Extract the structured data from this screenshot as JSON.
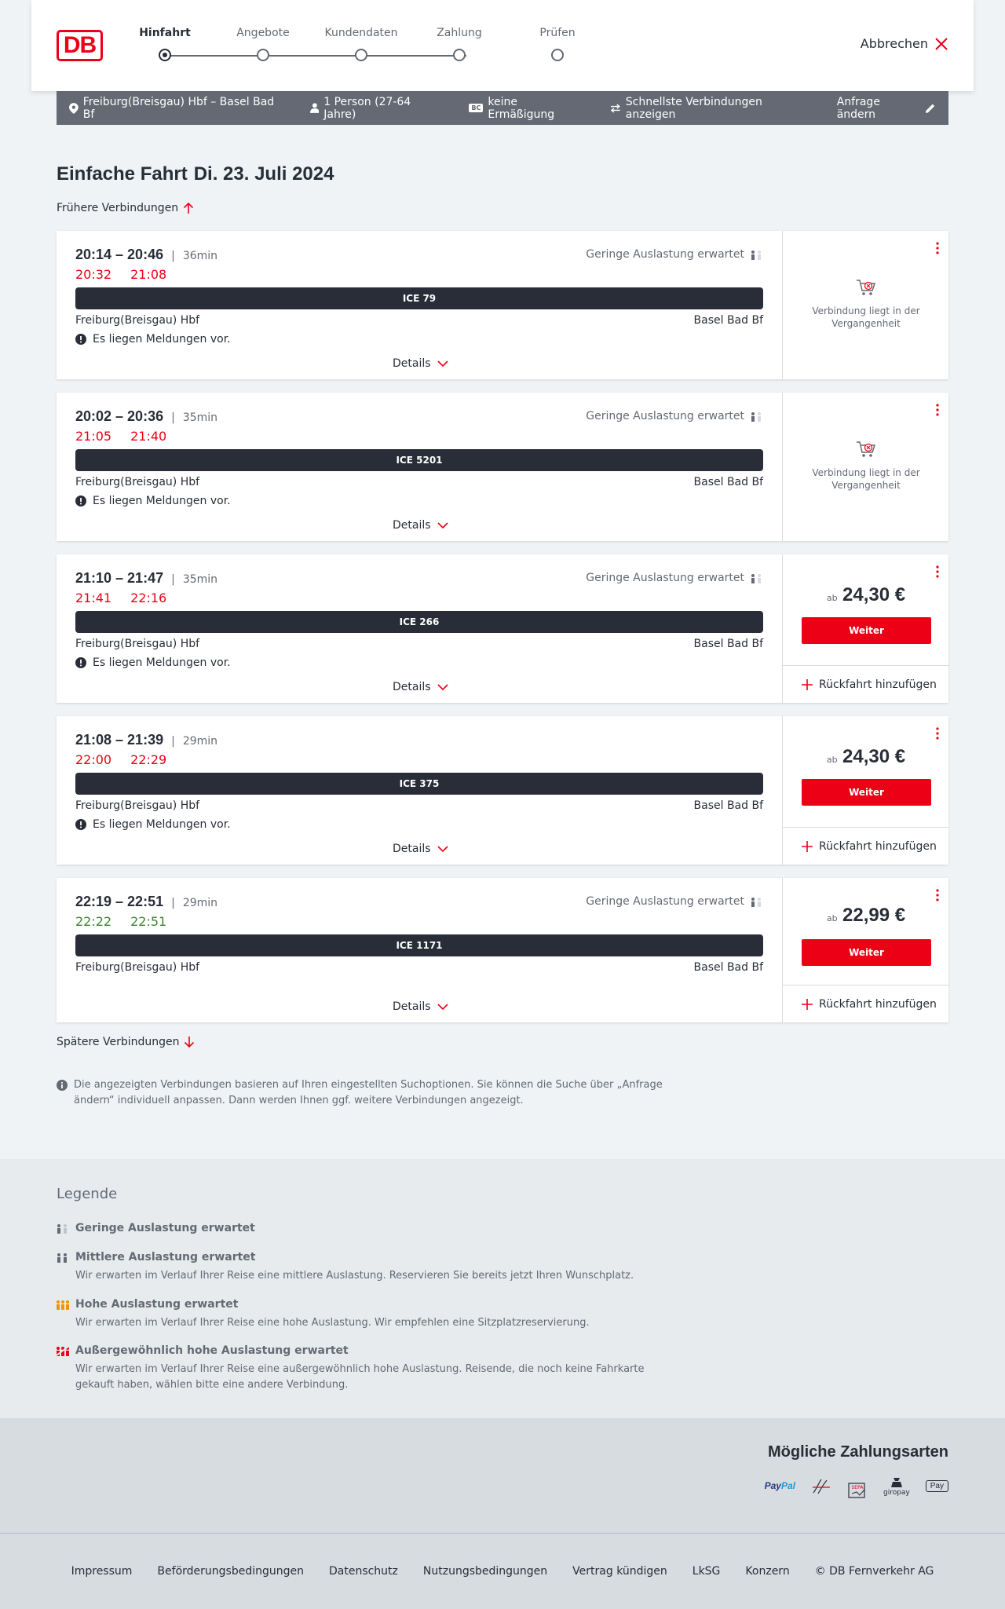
{
  "header": {
    "logo": "DB",
    "steps": [
      {
        "label": "Hinfahrt",
        "active": true
      },
      {
        "label": "Angebote",
        "active": false
      },
      {
        "label": "Kundendaten",
        "active": false
      },
      {
        "label": "Zahlung",
        "active": false
      },
      {
        "label": "Prüfen",
        "active": false
      }
    ],
    "cancel_label": "Abbrechen"
  },
  "infobar": {
    "route": "Freiburg(Breisgau) Hbf – Basel Bad Bf",
    "travellers": "1 Person (27-64 Jahre)",
    "discount_badge": "BC",
    "discount": "keine Ermäßigung",
    "filter": "Schnellste Verbindungen anzeigen",
    "change": "Anfrage ändern"
  },
  "heading": {
    "title": "Einfache Fahrt",
    "date": "Di. 23. Juli 2024"
  },
  "earlier_label": "Frühere Verbindungen",
  "later_label": "Spätere Verbindungen",
  "connections": [
    {
      "times": "20:14 – 20:46",
      "duration": "36min",
      "rt_dep": "20:32",
      "rt_arr": "21:08",
      "rt_color": "red",
      "load": "Geringe Auslastung erwartet",
      "train": "ICE 79",
      "from": "Freiburg(Breisgau) Hbf",
      "to": "Basel Bad Bf",
      "message": "Es liegen Meldungen vor.",
      "details": "Details",
      "status": "past",
      "past_text": "Verbindung liegt in der Vergangenheit"
    },
    {
      "times": "20:02 – 20:36",
      "duration": "35min",
      "rt_dep": "21:05",
      "rt_arr": "21:40",
      "rt_color": "red",
      "load": "Geringe Auslastung erwartet",
      "train": "ICE 5201",
      "from": "Freiburg(Breisgau) Hbf",
      "to": "Basel Bad Bf",
      "message": "Es liegen Meldungen vor.",
      "details": "Details",
      "status": "past",
      "past_text": "Verbindung liegt in der Vergangenheit"
    },
    {
      "times": "21:10 – 21:47",
      "duration": "35min",
      "rt_dep": "21:41",
      "rt_arr": "22:16",
      "rt_color": "red",
      "load": "Geringe Auslastung erwartet",
      "train": "ICE 266",
      "from": "Freiburg(Breisgau) Hbf",
      "to": "Basel Bad Bf",
      "message": "Es liegen Meldungen vor.",
      "details": "Details",
      "status": "bookable",
      "price_prefix": "ab",
      "price": "24,30 €",
      "button": "Weiter",
      "return_label": "Rückfahrt hinzufügen"
    },
    {
      "times": "21:08 – 21:39",
      "duration": "29min",
      "rt_dep": "22:00",
      "rt_arr": "22:29",
      "rt_color": "red",
      "load": "",
      "train": "ICE 375",
      "from": "Freiburg(Breisgau) Hbf",
      "to": "Basel Bad Bf",
      "message": "Es liegen Meldungen vor.",
      "details": "Details",
      "status": "bookable",
      "price_prefix": "ab",
      "price": "24,30 €",
      "button": "Weiter",
      "return_label": "Rückfahrt hinzufügen"
    },
    {
      "times": "22:19 – 22:51",
      "duration": "29min",
      "rt_dep": "22:22",
      "rt_arr": "22:51",
      "rt_color": "green",
      "load": "Geringe Auslastung erwartet",
      "train": "ICE 1171",
      "from": "Freiburg(Breisgau) Hbf",
      "to": "Basel Bad Bf",
      "message": "",
      "details": "Details",
      "status": "bookable",
      "price_prefix": "ab",
      "price": "22,99 €",
      "button": "Weiter",
      "return_label": "Rückfahrt hinzufügen"
    }
  ],
  "note": "Die angezeigten Verbindungen basieren auf Ihren eingestellten Suchoptionen. Sie können die Suche über „Anfrage ändern“ individuell anpassen. Dann werden Ihnen ggf. weitere Verbindungen angezeigt.",
  "legend": {
    "title": "Legende",
    "items": [
      {
        "title": "Geringe Auslastung erwartet",
        "desc": "",
        "icon_color": "#646973"
      },
      {
        "title": "Mittlere Auslastung erwartet",
        "desc": "Wir erwarten im Verlauf Ihrer Reise eine mittlere Auslastung. Reservieren Sie bereits jetzt Ihren Wunschplatz.",
        "icon_color": "#646973"
      },
      {
        "title": "Hohe Auslastung erwartet",
        "desc": "Wir erwarten im Verlauf Ihrer Reise eine hohe Auslastung. Wir empfehlen eine Sitzplatzreservierung.",
        "icon_color": "#f39200"
      },
      {
        "title": "Außergewöhnlich hohe Auslastung erwartet",
        "desc": "Wir erwarten im Verlauf Ihrer Reise eine außergewöhnlich hohe Auslastung. Reisende, die noch keine Fahrkarte gekauft haben, wählen bitte eine andere Verbindung.",
        "icon_color": "#ec0016"
      }
    ]
  },
  "payment": {
    "title": "Mögliche Zahlungsarten",
    "methods": [
      "PayPal",
      "Lastschrift",
      "SEPA",
      "giropay",
      "Apple Pay"
    ],
    "paypal_a": "Pay",
    "paypal_b": "Pal",
    "sepa_label": "SEPA",
    "giropay_label": "giropay",
    "applepay_label": "Pay"
  },
  "footer": {
    "links": [
      "Impressum",
      "Beförderungsbedingungen",
      "Datenschutz",
      "Nutzungsbedingungen",
      "Vertrag kündigen",
      "LkSG",
      "Konzern",
      "© DB Fernverkehr AG"
    ]
  },
  "colors": {
    "brand_red": "#ec0016",
    "dark": "#282d37",
    "grey": "#646973",
    "green": "#408335"
  }
}
